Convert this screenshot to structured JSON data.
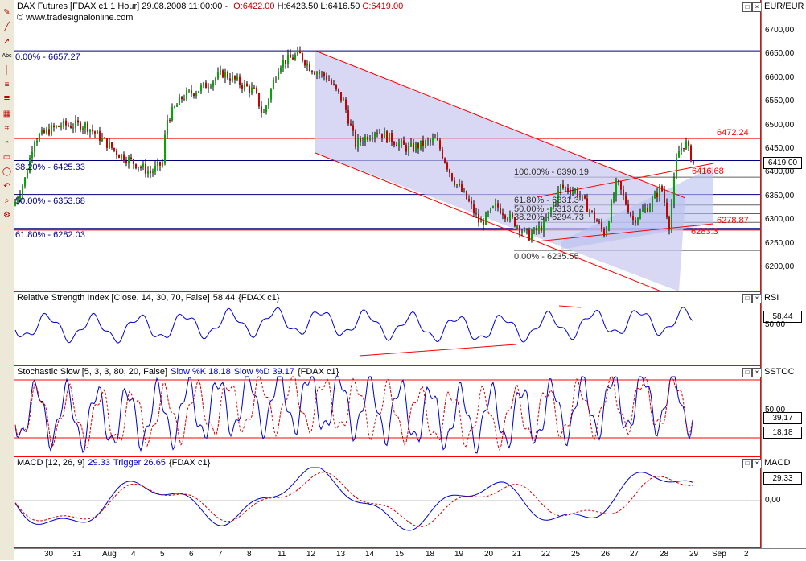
{
  "toolbar": {
    "tools": [
      "pencil",
      "line",
      "arrow",
      "text",
      "pen",
      "fib",
      "fib-ext",
      "channel",
      "gann",
      "cycle",
      "rect",
      "ellipse",
      "undo",
      "zoom",
      "settings"
    ]
  },
  "main": {
    "title": "DAX Futures [FDAX c1  1 Hour] 29.08.2008 11:00:00 - O:6422.00 H:6423.50 L:6416.50 C:6419.00",
    "title_parts": {
      "name": "DAX Futures [FDAX c1  1 Hour] 29.08.2008 11:00:00 - ",
      "open": "O:6422.00",
      "high": " H:6423.50",
      "low": " L:6416.50",
      "close": " C:6419.00"
    },
    "website": "www.tradesignalonline.com",
    "axis_title": "EUR/EUR",
    "price_ticks": [
      "6700,00",
      "6650,00",
      "6600,00",
      "6550,00",
      "6500,00",
      "6450,00",
      "6400,00",
      "6350,00",
      "6300,00",
      "6250,00",
      "6200,00"
    ],
    "last_price_tag": "6419,00",
    "fib_left": [
      "0.00% - 6657.27",
      "38.20% - 6425.33",
      "50.00% - 6353.68",
      "61.80% - 6282.03"
    ],
    "fib_right": [
      "100.00% - 6390.19",
      "61.80% - 6331.3",
      "50.00% - 6313.02",
      "38.20% - 6294.73",
      "0.00% - 6235.55"
    ],
    "red_labels": [
      "6472.24",
      "6416.68",
      "6278.87",
      "6283.3"
    ]
  },
  "rsi": {
    "title": "Relative Strength Index [Close, 14, 30, 70, False]",
    "value": "58.44",
    "symbol": "{FDAX c1}",
    "axis_title": "RSI",
    "tag": "58,44",
    "tick": "50,00"
  },
  "stoch": {
    "title": "Stochastic Slow [5, 3, 3, 80, 20, False]",
    "k": "Slow %K 18.18",
    "d": "Slow %D 39.17",
    "symbol": "{FDAX c1}",
    "axis_title": "SSTOC",
    "tick": "50,00",
    "tag1": "39,17",
    "tag2": "18,18"
  },
  "macd": {
    "title": "MACD [12, 26, 9]",
    "value": "29.33",
    "trigger": "Trigger 26.65",
    "symbol": "{FDAX c1}",
    "axis_title": "MACD",
    "tag": "29,33",
    "tick": "0,00"
  },
  "xaxis": {
    "labels": [
      "30",
      "31",
      "Aug",
      "4",
      "5",
      "6",
      "7",
      "8",
      "11",
      "12",
      "13",
      "14",
      "15",
      "18",
      "19",
      "20",
      "21",
      "22",
      "25",
      "26",
      "27",
      "28",
      "29",
      "Sep",
      "2"
    ]
  },
  "colors": {
    "up": "#00aa00",
    "down": "#cc0000",
    "frame": "#ff0000",
    "series": "#0000cc",
    "trigger": "#cc0000"
  }
}
